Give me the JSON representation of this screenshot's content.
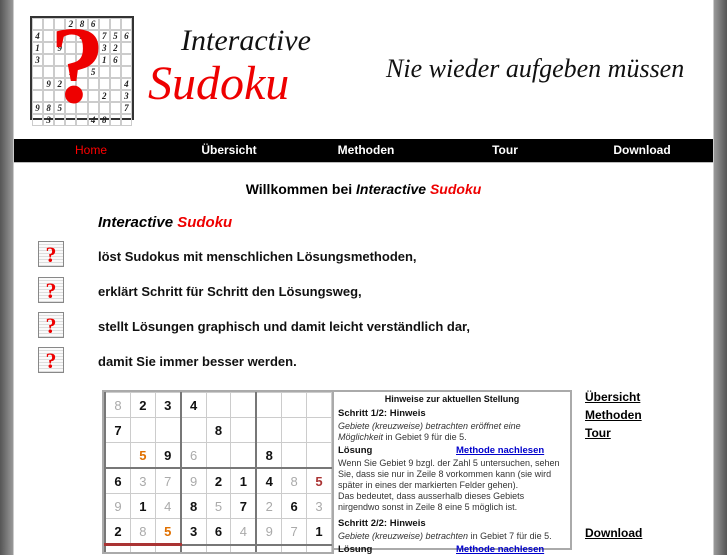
{
  "header": {
    "logo_grid": [
      "   286   ",
      "4   3 756",
      "1 9   32 ",
      "3     16 ",
      "   7 5   ",
      " 92     4",
      "      2 3",
      "985     7",
      " 3   48  "
    ],
    "logo_line1": "Interactive",
    "logo_line2": "Sudoku",
    "tagline": "Nie wieder aufgeben müssen"
  },
  "nav": {
    "items": [
      {
        "label": "Home",
        "active": true
      },
      {
        "label": "Übersicht"
      },
      {
        "label": "Methoden"
      },
      {
        "label": "Tour"
      },
      {
        "label": "Download"
      }
    ]
  },
  "main": {
    "welcome_prefix": "Willkommen bei ",
    "welcome_italic": "Interactive",
    "welcome_red": "Sudoku",
    "sub_italic": "Interactive",
    "sub_red": "Sudoku",
    "features": [
      "löst Sudokus mit menschlichen Lösungsmethoden,",
      "erklärt Schritt für Schritt den Lösungsweg,",
      "stellt Lösungen graphisch und damit leicht verständlich dar,",
      "damit Sie immer besser werden."
    ],
    "accent_color": "#e00000"
  },
  "board": {
    "rows": [
      {
        "v": "8234     ",
        "c": "gbbb     "
      },
      {
        "v": "7   8    ",
        "c": "b   b    "
      },
      {
        "v": " 596  8  ",
        "c": " obg  b  "
      },
      {
        "v": "637921485",
        "c": "bgggbbbgr"
      },
      {
        "v": "914857263",
        "c": "gbgbgbgbg"
      },
      {
        "v": "285364971",
        "c": "bgobbgggb"
      },
      {
        "v": "         ",
        "c": "         "
      }
    ]
  },
  "hints": {
    "title": "Hinweise zur aktuellen Stellung",
    "step1": "Schritt 1/2: Hinweis",
    "step1_italic": "Gebiete (kreuzweise) betrachten eröffnet eine Möglichkeit",
    "step1_rest": " in Gebiet 9 für die 5.",
    "solution_label": "Lösung",
    "method_link": "Methode nachlesen",
    "solution_text1": "Wenn Sie Gebiet 9 bzgl. der Zahl 5 untersuchen, sehen Sie, dass sie nur in Zeile 8 vorkommen kann (sie wird später in eines der markierten Felder gehen).",
    "solution_text2": "Das bedeutet, dass ausserhalb dieses Gebiets nirgendwo sonst in Zeile 8 eine 5 möglich ist.",
    "step2": "Schritt 2/2: Hinweis",
    "step2_italic": "Gebiete (kreuzweise) betrachten",
    "step2_rest": " in Gebiet 7 für die 5.",
    "solution2_label": "Lösung",
    "method_link2": "Methode nachlesen"
  },
  "side_links": [
    "Übersicht",
    "Methoden",
    "Tour",
    "Download"
  ]
}
